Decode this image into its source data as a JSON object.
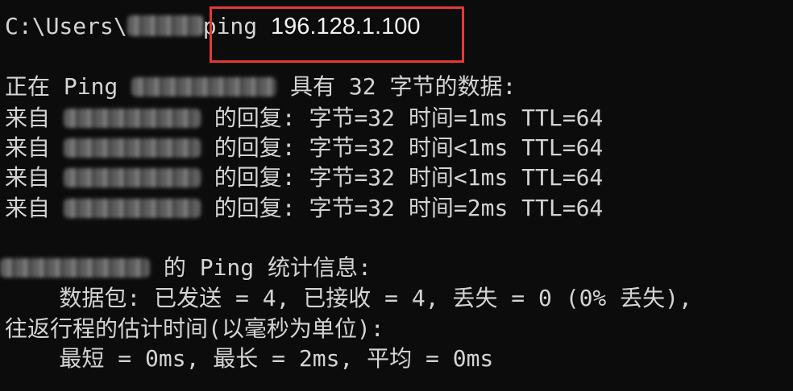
{
  "prompt": {
    "prefix": "C:\\Users\\",
    "command": "ping",
    "target": "196.128.1.100"
  },
  "header": {
    "prefix": "正在 Ping",
    "suffix": "具有 32 字节的数据:"
  },
  "replies": [
    {
      "from": "来自",
      "text": "的回复: 字节=32 时间=1ms TTL=64"
    },
    {
      "from": "来自",
      "text": "的回复: 字节=32 时间<1ms TTL=64"
    },
    {
      "from": "来自",
      "text": "的回复: 字节=32 时间<1ms TTL=64"
    },
    {
      "from": "来自",
      "text": "的回复: 字节=32 时间=2ms TTL=64"
    }
  ],
  "stats": {
    "title": "的 Ping 统计信息:",
    "packets": "    数据包: 已发送 = 4, 已接收 = 4, 丢失 = 0 (0% 丢失),",
    "rtt_title": "往返行程的估计时间(以毫秒为单位):",
    "rtt_values": "    最短 = 0ms, 最长 = 2ms, 平均 = 0ms"
  },
  "colors": {
    "background": "#0c0c0c",
    "text": "#d4d4d4",
    "highlight": "#e53935"
  }
}
